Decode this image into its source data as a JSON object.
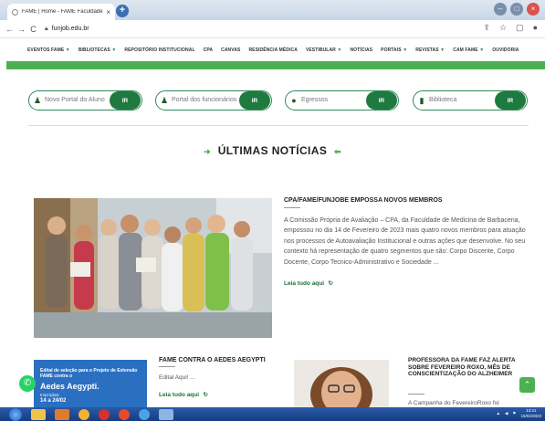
{
  "browser": {
    "tab_title": "FAME | Home - FAME Faculdade",
    "url": "funjob.edu.br"
  },
  "nav": {
    "items": [
      {
        "label": "EVENTOS FAME",
        "caret": true
      },
      {
        "label": "BIBLIOTECAS",
        "caret": true
      },
      {
        "label": "REPOSITÓRIO INSTITUCIONAL",
        "caret": false
      },
      {
        "label": "CPA",
        "caret": false
      },
      {
        "label": "CANVAS",
        "caret": false
      },
      {
        "label": "RESIDÊNCIA MÉDICA",
        "caret": false
      },
      {
        "label": "VESTIBULAR",
        "caret": true
      },
      {
        "label": "NOTÍCIAS",
        "caret": false
      },
      {
        "label": "PORTAIS",
        "caret": true
      },
      {
        "label": "REVISTAS",
        "caret": true
      },
      {
        "label": "CAM FAME",
        "caret": true
      },
      {
        "label": "OUVIDORIA",
        "caret": false
      }
    ]
  },
  "quick_links": [
    {
      "label": "Novo Portal do Aluno",
      "button": "IR",
      "icon": "user-icon"
    },
    {
      "label": "Portal dos funcionários",
      "button": "IR",
      "icon": "users-icon"
    },
    {
      "label": "Egressos",
      "button": "IR",
      "icon": "chat-icon"
    },
    {
      "label": "Biblioteca",
      "button": "IR",
      "icon": "book-icon"
    }
  ],
  "section_title": "ÚLTIMAS NOTÍCIAS",
  "featured": {
    "title": "CPA/FAME/FUNJOBE EMPOSSA NOVOS MEMBROS",
    "body": "A Comissão Própria de Avaliação – CPA, da Faculdade de Medicina de Barbacena, empossou no dia 14 de Fevereiro de 2023 mais quatro novos membros para atuação nos processos de Autoavaliação Institucional e outras ações que desenvolve. No seu contexto há representação de quatro segmentos que são: Corpo Discente, Corpo Docente, Corpo Tecnico-Administrativo e Sociedade ...",
    "read_more": "Leia tudo aqui"
  },
  "news2": {
    "title": "FAME CONTRA O AEDES AEGYPTI",
    "body": "Edital Aqui! ...",
    "read_more": "Leia tudo aqui",
    "banner": {
      "line1": "Edital de seleção para o Projeto de Extensão FAME contra o",
      "line2": "Aedes Aegypti.",
      "line3": "Inscrições:",
      "line4": "14 a 24/02"
    }
  },
  "news3": {
    "title": "PROFESSORA DA FAME FAZ ALERTA SOBRE FEVEREIRO ROXO, MÊS DE CONSCIENTIZAÇÃO DO ALZHEIMER",
    "body": "A Campanha do FevereiroRoxo foi"
  },
  "taskbar": {
    "time": "13:41",
    "date": "15/02/2023"
  }
}
